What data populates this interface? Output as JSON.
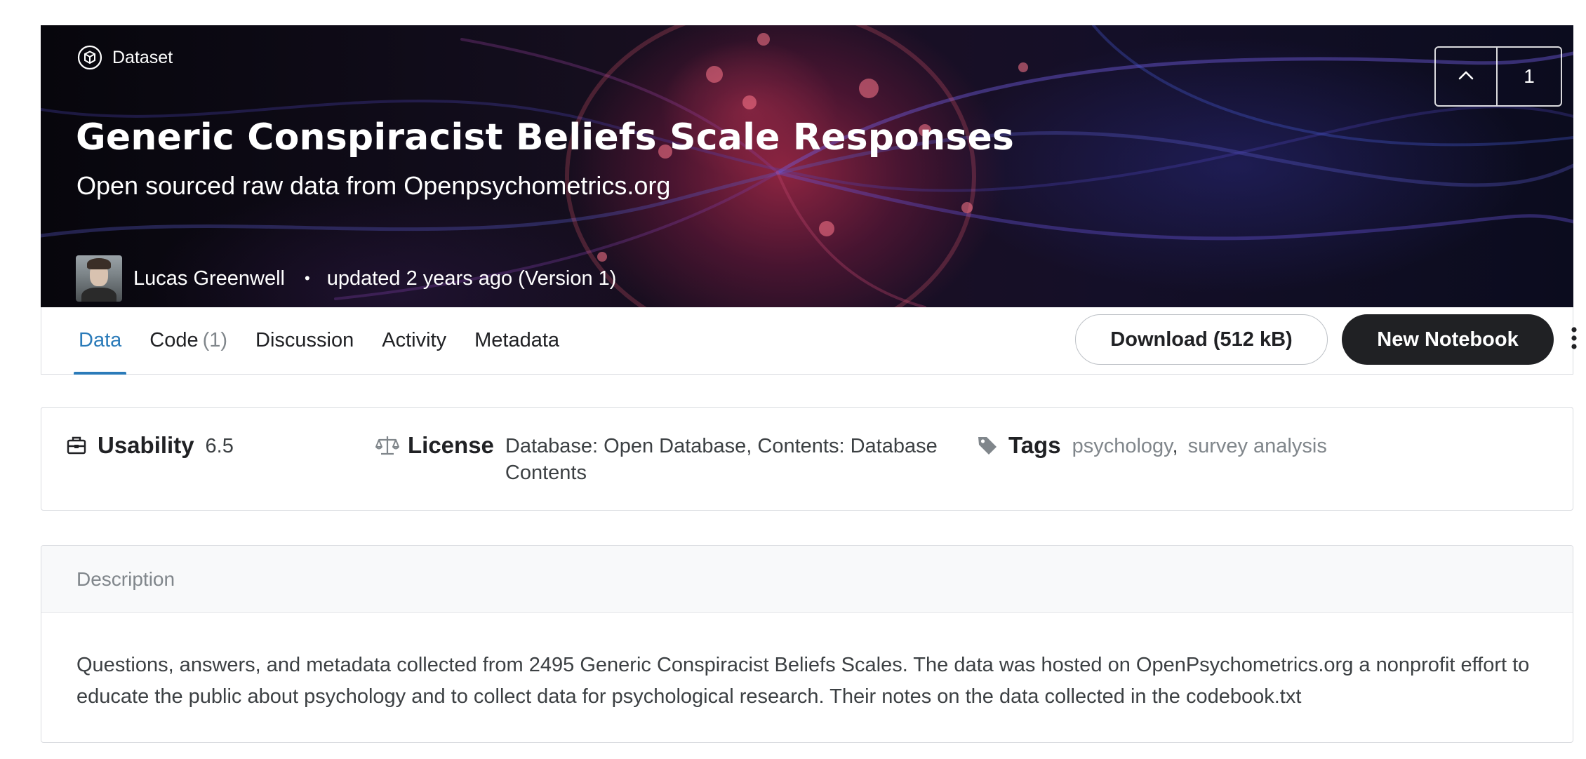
{
  "hero": {
    "kind_label": "Dataset",
    "title": "Generic Conspiracist Beliefs Scale Responses",
    "subtitle": "Open sourced raw data from Openpsychometrics.org",
    "owner_name": "Lucas Greenwell",
    "separator": "•",
    "updated_text": "updated 2 years ago (Version 1)",
    "upvote_count": "1"
  },
  "tabs": [
    {
      "label": "Data",
      "count": "",
      "active": true
    },
    {
      "label": "Code",
      "count": "(1)",
      "active": false
    },
    {
      "label": "Discussion",
      "count": "",
      "active": false
    },
    {
      "label": "Activity",
      "count": "",
      "active": false
    },
    {
      "label": "Metadata",
      "count": "",
      "active": false
    }
  ],
  "actions": {
    "download_label": "Download (512 kB)",
    "new_notebook_label": "New Notebook"
  },
  "meta": {
    "usability_label": "Usability",
    "usability_value": "6.5",
    "license_label": "License",
    "license_value": "Database: Open Database, Contents: Database Contents",
    "tags_label": "Tags",
    "tags": [
      "psychology",
      "survey analysis"
    ],
    "tag_separator": ","
  },
  "description": {
    "header": "Description",
    "body": "Questions, answers, and metadata collected from 2495 Generic Conspiracist Beliefs Scales. The data was hosted on OpenPsychometrics.org a nonprofit effort to educate the public about psychology and to collect data for psychological research. Their notes on the data collected in the codebook.txt"
  },
  "colors": {
    "accent": "#2b7bb9",
    "primary_button": "#202124",
    "muted_text": "#80868b",
    "border": "#dadce0"
  },
  "icons": {
    "dataset": "dataset-cube-icon",
    "upvote": "chevron-up-icon",
    "more": "more-vertical-icon",
    "usability": "briefcase-icon",
    "license": "scale-icon",
    "tags": "tag-icon"
  }
}
